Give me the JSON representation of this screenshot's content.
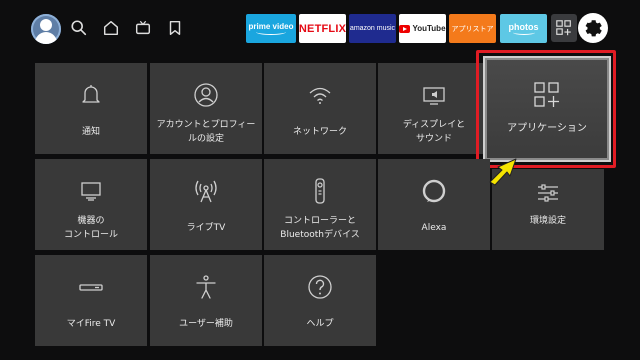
{
  "topbar": {
    "apps": {
      "prime_video": "prime video",
      "netflix": "NETFLIX",
      "amazon_music": "amazon music",
      "youtube": "YouTube",
      "appstore": "アプリストア",
      "photos": "photos"
    }
  },
  "tiles": {
    "notifications": "通知",
    "account": "アカウントとプロフィー\nルの設定",
    "network": "ネットワーク",
    "display_sound": "ディスプレイと\nサウンド",
    "applications": "アプリケーション",
    "device_control": "機器の\nコントロール",
    "live_tv": "ライブTV",
    "controllers": "コントローラーと\nBluetoothデバイス",
    "alexa": "Alexa",
    "preferences": "環境設定",
    "my_fire_tv": "マイFire TV",
    "accessibility": "ユーザー補助",
    "help": "ヘルプ"
  },
  "colors": {
    "background": "#0d0d0e",
    "tile": "#393939",
    "highlight_frame": "#e01c24",
    "pointer_arrow": "#f5e400"
  }
}
